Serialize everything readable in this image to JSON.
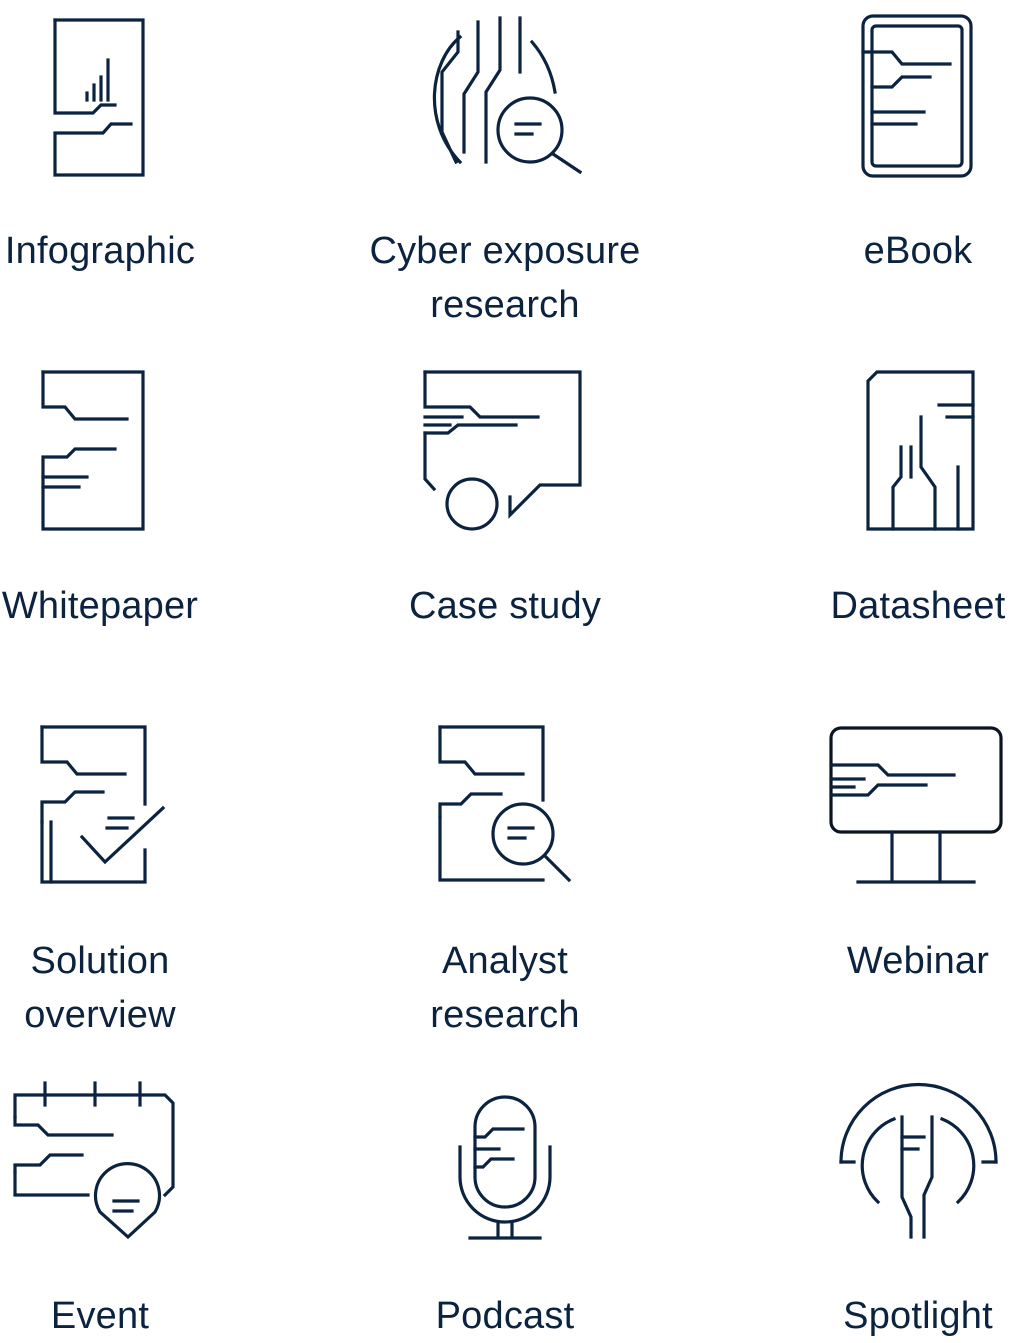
{
  "brand": {
    "ink_color": "#0c2340",
    "background": "#ffffff"
  },
  "resources": [
    {
      "label": "Infographic",
      "icon": "infographic-icon"
    },
    {
      "label": "Cyber exposure\nresearch",
      "icon": "cyber-exposure-research-icon"
    },
    {
      "label": "eBook",
      "icon": "ebook-icon"
    },
    {
      "label": "Whitepaper",
      "icon": "whitepaper-icon"
    },
    {
      "label": "Case study",
      "icon": "case-study-icon"
    },
    {
      "label": "Datasheet",
      "icon": "datasheet-icon"
    },
    {
      "label": "Solution\noverview",
      "icon": "solution-overview-icon"
    },
    {
      "label": "Analyst\nresearch",
      "icon": "analyst-research-icon"
    },
    {
      "label": "Webinar",
      "icon": "webinar-icon"
    },
    {
      "label": "Event",
      "icon": "event-icon"
    },
    {
      "label": "Podcast",
      "icon": "podcast-icon"
    },
    {
      "label": "Spotlight",
      "icon": "spotlight-icon"
    }
  ]
}
